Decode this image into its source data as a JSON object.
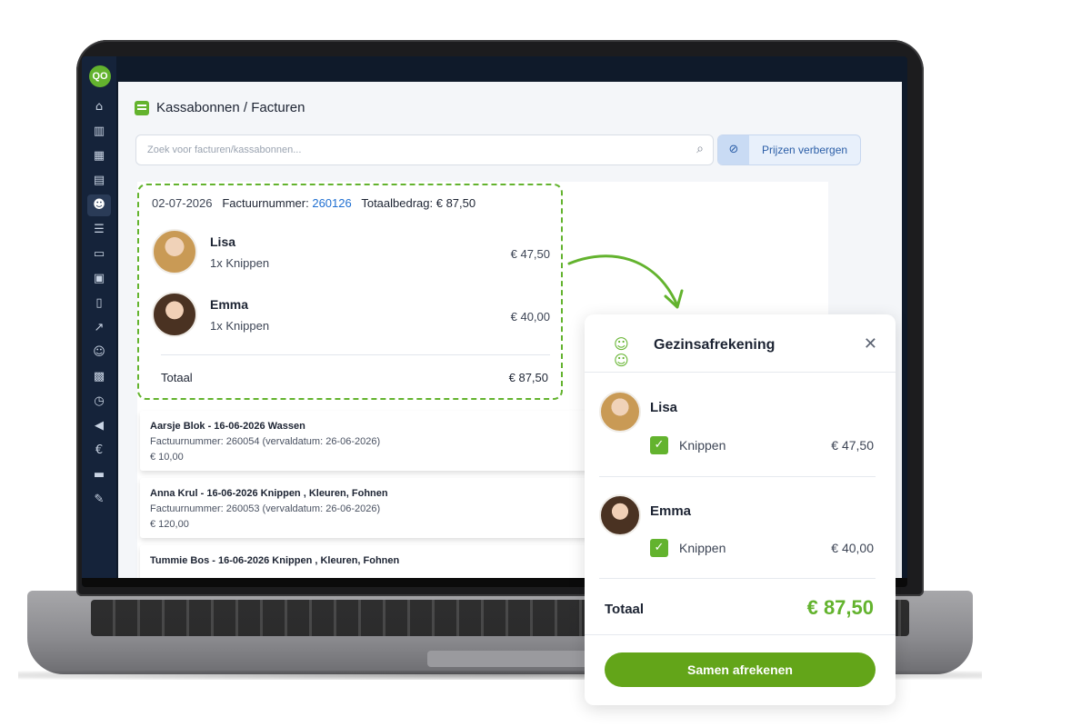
{
  "app": {
    "logo_text": "QO",
    "page_title": "Kassabonnen / Facturen",
    "page_icon": "receipt-icon",
    "accent_color": "#63b32e"
  },
  "sidebar": {
    "items": [
      {
        "icon": "home-icon",
        "glyph": "⌂"
      },
      {
        "icon": "chart-icon",
        "glyph": "▥"
      },
      {
        "icon": "calendar-icon",
        "glyph": "▦"
      },
      {
        "icon": "register-icon",
        "glyph": "▤"
      },
      {
        "icon": "users-icon",
        "glyph": "☻",
        "active": true
      },
      {
        "icon": "list-icon",
        "glyph": "☰"
      },
      {
        "icon": "id-card-icon",
        "glyph": "▭"
      },
      {
        "icon": "box-icon",
        "glyph": "▣"
      },
      {
        "icon": "book-icon",
        "glyph": "▯"
      },
      {
        "icon": "trend-icon",
        "glyph": "↗"
      },
      {
        "icon": "group-icon",
        "glyph": "☺"
      },
      {
        "icon": "contact-card-icon",
        "glyph": "▩"
      },
      {
        "icon": "clock-icon",
        "glyph": "◷"
      },
      {
        "icon": "megaphone-icon",
        "glyph": "◀"
      },
      {
        "icon": "euro-icon",
        "glyph": "€"
      },
      {
        "icon": "credit-card-icon",
        "glyph": "▬"
      },
      {
        "icon": "edit-icon",
        "glyph": "✎"
      }
    ]
  },
  "search": {
    "placeholder": "Zoek voor facturen/kassabonnen...",
    "icon": "search-icon"
  },
  "hide_prices_button": {
    "label": "Prijzen verbergen",
    "icon": "eye-off-icon"
  },
  "invoice": {
    "date": "02-07-2026",
    "number_label": "Factuurnummer:",
    "number": "260126",
    "total_label_head": "Totaalbedrag: € 87,50",
    "persons": [
      {
        "name": "Lisa",
        "service": "1x Knippen",
        "amount": "€ 47,50"
      },
      {
        "name": "Emma",
        "service": "1x Knippen",
        "amount": "€ 40,00"
      }
    ],
    "total_label": "Totaal",
    "total_amount": "€ 87,50"
  },
  "invoice_list": [
    {
      "title": "Aarsje Blok - 16-06-2026 Wassen",
      "line2": "Factuurnummer: 260054 (vervaldatum: 26-06-2026)",
      "line3": "€ 10,00"
    },
    {
      "title": "Anna Krul - 16-06-2026 Knippen , Kleuren, Fohnen",
      "line2": "Factuurnummer: 260053 (vervaldatum: 26-06-2026)",
      "line3": "€ 120,00"
    },
    {
      "title": "Tummie Bos - 16-06-2026 Knippen , Kleuren, Fohnen",
      "line2": "",
      "line3": ""
    }
  ],
  "modal": {
    "title": "Gezinsafrekening",
    "icon": "family-icon",
    "persons": [
      {
        "name": "Lisa",
        "service": "Knippen",
        "amount": "€ 47,50",
        "checked": true
      },
      {
        "name": "Emma",
        "service": "Knippen",
        "amount": "€ 40,00",
        "checked": true
      }
    ],
    "total_label": "Totaal",
    "total_amount": "€ 87,50",
    "button_label": "Samen afrekenen"
  }
}
